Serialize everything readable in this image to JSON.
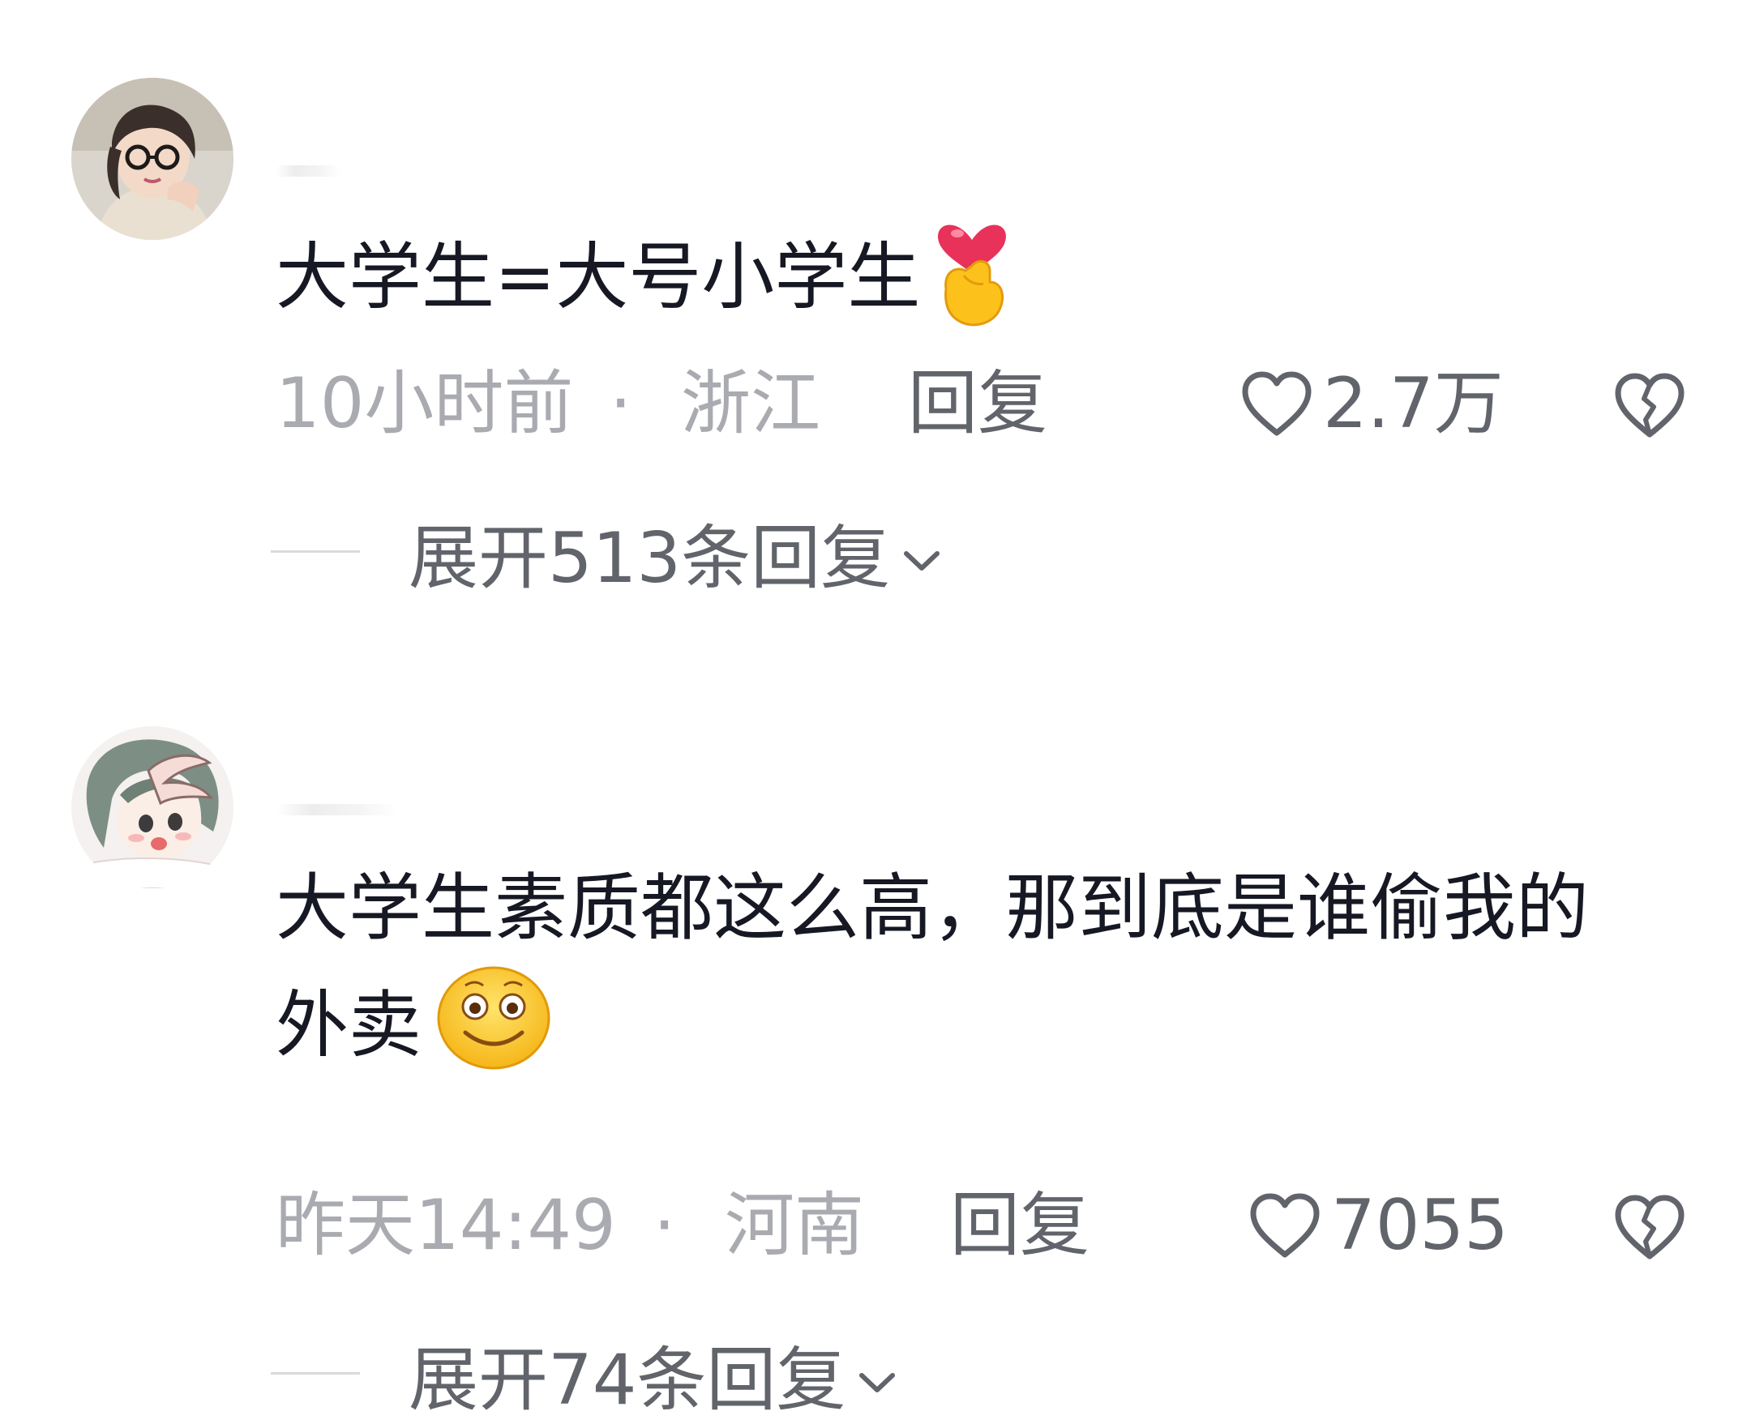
{
  "comments": [
    {
      "avatar_icon": "user-avatar-photo",
      "text": "大学生=大号小学生",
      "emoji_icon": "finger-heart-emoji",
      "time": "10小时前",
      "separator": "·",
      "location": "浙江",
      "reply_label": "回复",
      "like_count": "2.7万",
      "expand_label": "展开513条回复"
    },
    {
      "avatar_icon": "user-avatar-anime",
      "text": "大学生素质都这么高，那到底是谁偷我的外卖",
      "emoji_icon": "smiling-face-emoji",
      "time": "昨天14:49",
      "separator": "·",
      "location": "河南",
      "reply_label": "回复",
      "like_count": "7055",
      "expand_label": "展开74条回复"
    }
  ],
  "colors": {
    "primary_text": "#161823",
    "secondary_text": "#a9abb1",
    "action_text": "#61646b",
    "divider": "#d9dadc"
  }
}
